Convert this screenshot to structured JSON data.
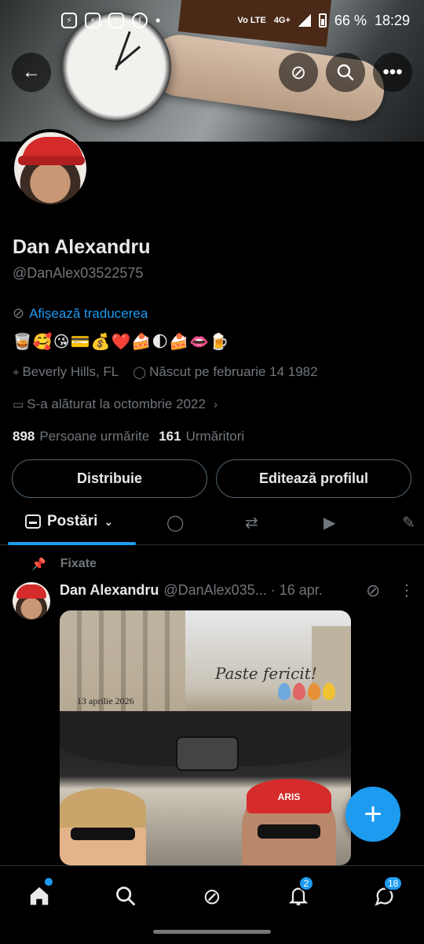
{
  "status_bar": {
    "network": "4G+",
    "lte": "Vo LTE",
    "battery": "66 %",
    "time": "18:29",
    "notif_icons": [
      "messenger-icon",
      "messenger-icon",
      "messenger-icon",
      "facebook-icon"
    ]
  },
  "profile": {
    "name": "Dan Alexandru",
    "handle": "@DanAlex03522575",
    "translate_label": "Afișează traducerea",
    "bio_emojis": "🥃🥰😘💳💰❤️🍰🌓🍰👄🍺",
    "location": "Beverly Hills, FL",
    "birth": "Născut pe februarie 14 1982",
    "joined": "S-a alăturat la octombrie 2022",
    "following_count": "898",
    "following_label": "Persoane urmărite",
    "followers_count": "161",
    "followers_label": "Urmăritori"
  },
  "buttons": {
    "share": "Distribuie",
    "edit": "Editează profilul"
  },
  "tabs": {
    "posts": "Postări"
  },
  "post": {
    "pinned_label": "Fixate",
    "author": "Dan Alexandru",
    "handle_time": "@DanAlex035... · 16 apr.",
    "image_greeting": "Paste fericit!",
    "image_date": "13 aprilie 2026",
    "image_cap_text": "ARIS"
  },
  "nav": {
    "notif_badge": "2",
    "msg_badge": "18"
  },
  "colors": {
    "accent": "#1d9bf0",
    "background": "#000000",
    "secondary_text": "#71767b"
  }
}
